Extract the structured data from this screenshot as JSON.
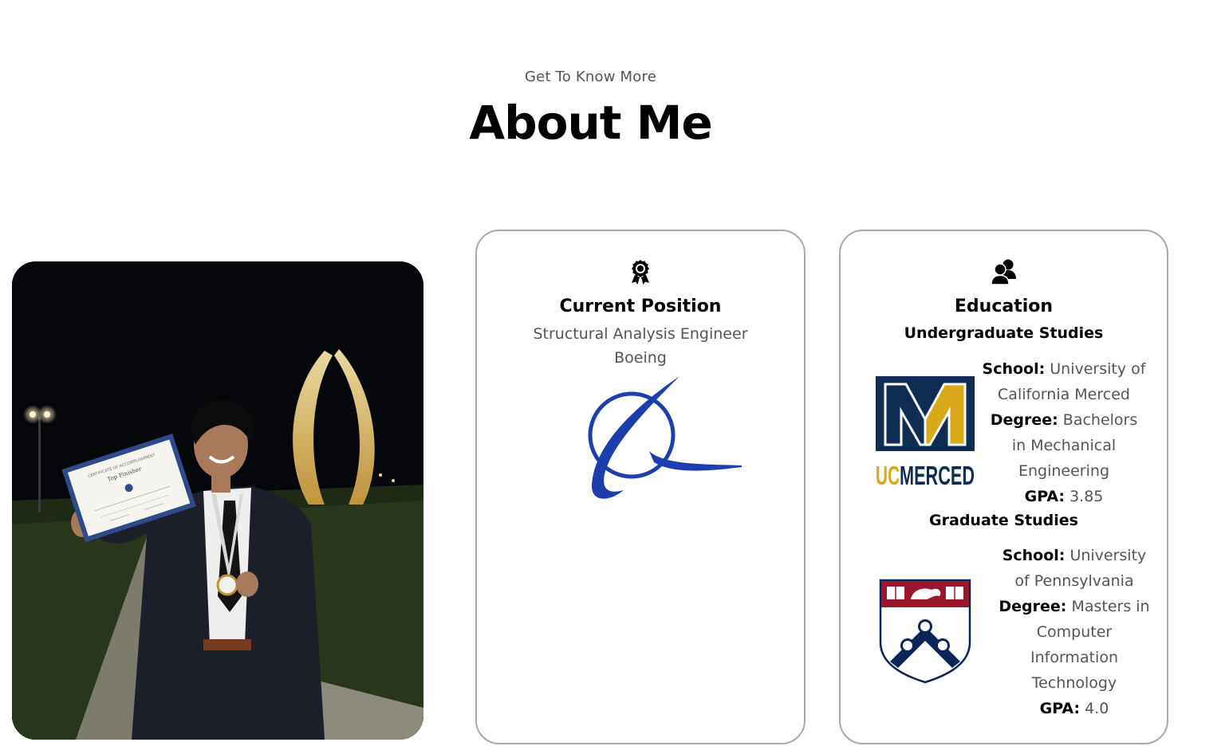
{
  "header": {
    "subtitle": "Get To Know More",
    "title": "About Me"
  },
  "photo": {
    "certificate_heading": "CERTIFICATE OF ACCOMPLISHMENT",
    "certificate_line": "Top Finisher"
  },
  "position_card": {
    "icon": "award-icon",
    "title": "Current Position",
    "role": "Structural Analysis Engineer",
    "company": "Boeing",
    "logo": "boeing-logo"
  },
  "education_card": {
    "icon": "users-icon",
    "title": "Education",
    "undergrad": {
      "heading": "Undergraduate Studies",
      "logo_text": "UCMERCED",
      "logo_text_uc": "UC",
      "logo_text_merced": "MERCED",
      "school_label": "School:",
      "school_value": "University of California Merced",
      "degree_label": "Degree:",
      "degree_value": "Bachelors in Mechanical Engineering",
      "gpa_label": "GPA:",
      "gpa_value": "3.85"
    },
    "grad": {
      "heading": "Graduate Studies",
      "logo": "penn-shield-logo",
      "school_label": "School:",
      "school_value": "University of Pennsylvania",
      "degree_label": "Degree:",
      "degree_value": "Masters in Computer Information Technology",
      "gpa_label": "GPA:",
      "gpa_value": "4.0"
    }
  },
  "colors": {
    "boeing_blue": "#1d3fae",
    "ucm_navy": "#0f2d52",
    "ucm_gold": "#d9a91a",
    "penn_red": "#99182e",
    "penn_navy": "#0b2559",
    "card_border": "#a9a9a9"
  }
}
